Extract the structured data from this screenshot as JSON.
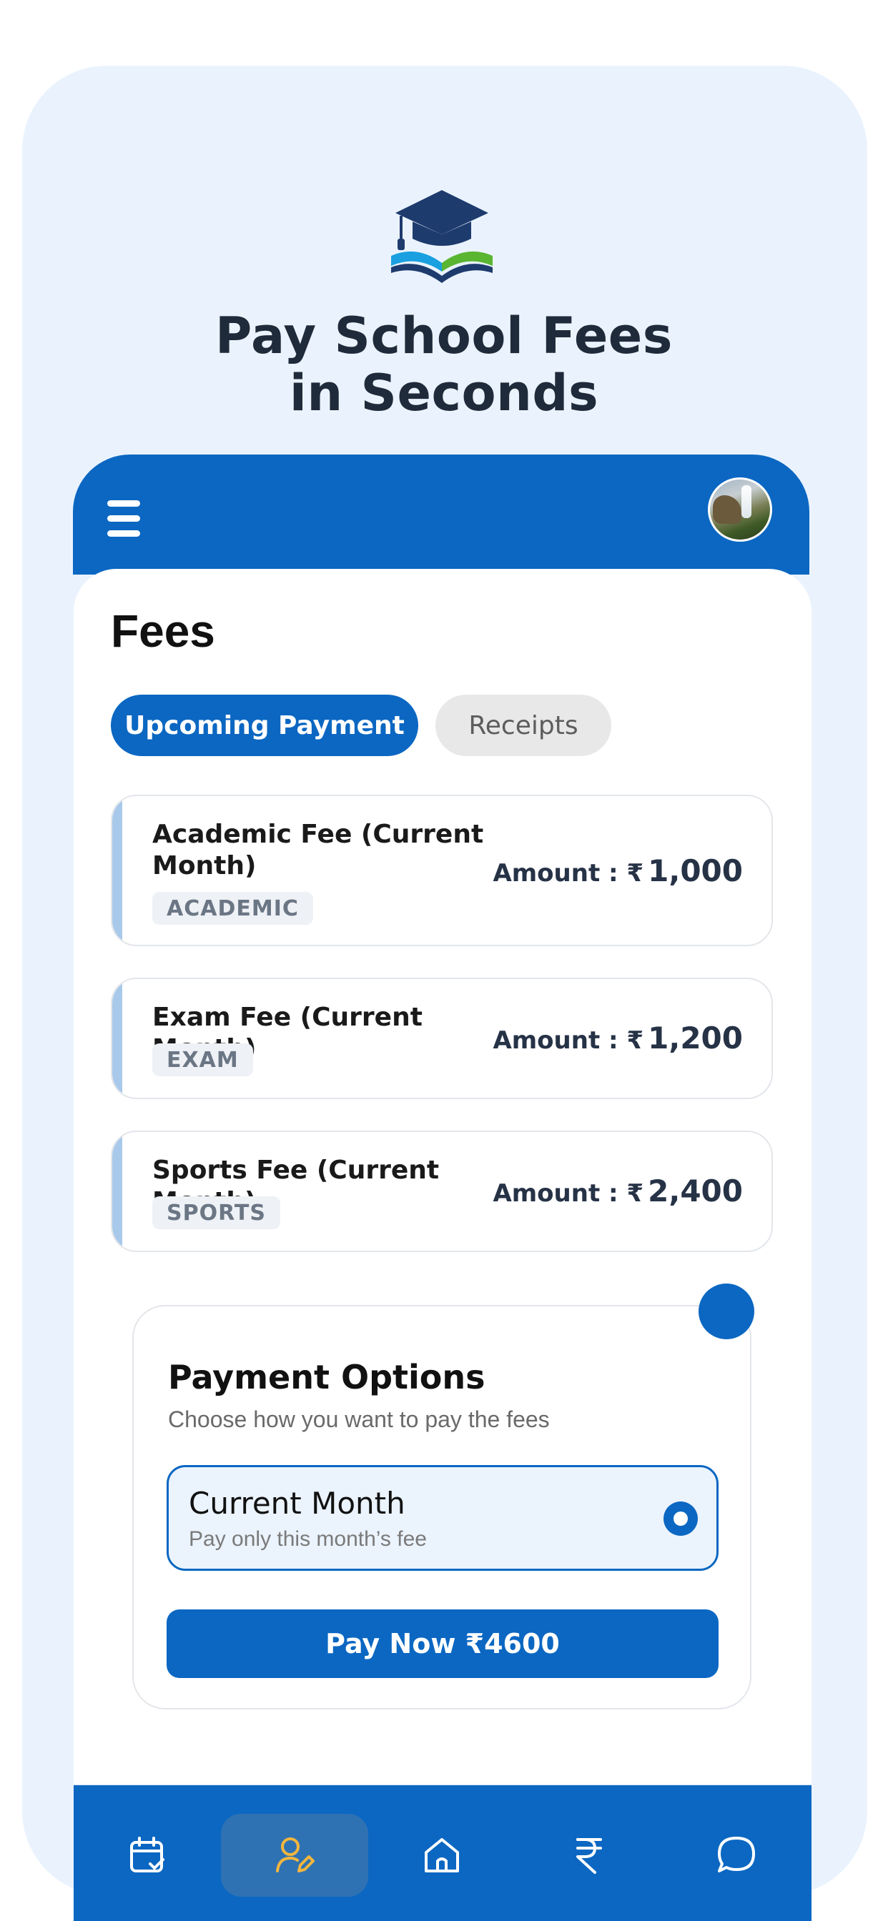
{
  "hero": {
    "title_line1": "Pay School Fees",
    "title_line2": "in Seconds"
  },
  "colors": {
    "primary": "#0b67c2",
    "panel_bg": "#eaf3fd",
    "accent_yellow": "#f3b63d",
    "logo_navy": "#1e3b6e",
    "logo_blue": "#1aa0e0",
    "logo_green": "#5ab531"
  },
  "header": {
    "menu_icon": "hamburger-icon",
    "avatar": "profile-avatar"
  },
  "page": {
    "title": "Fees"
  },
  "tabs": [
    {
      "label": "Upcoming Payment",
      "active": true
    },
    {
      "label": "Receipts",
      "active": false
    }
  ],
  "fees": [
    {
      "name": "Academic Fee (Current Month)",
      "tag": "ACADEMIC",
      "amount_label": "Amount : ₹",
      "amount": "1,000"
    },
    {
      "name": "Exam Fee (Current Month)",
      "tag": "EXAM",
      "amount_label": "Amount : ₹",
      "amount": "1,200"
    },
    {
      "name": "Sports Fee (Current Month)",
      "tag": "SPORTS",
      "amount_label": "Amount : ₹",
      "amount": "2,400"
    }
  ],
  "payment_options": {
    "title": "Payment Options",
    "subtitle": "Choose how you want to pay the fees",
    "option": {
      "title": "Current Month",
      "subtitle": "Pay only this month’s fee",
      "selected": true
    },
    "pay_button": "Pay Now ₹4600"
  },
  "bottom_nav": [
    {
      "icon": "calendar-check-icon",
      "active": false
    },
    {
      "icon": "user-edit-icon",
      "active": true
    },
    {
      "icon": "home-icon",
      "active": false
    },
    {
      "icon": "rupee-icon",
      "active": false
    },
    {
      "icon": "chat-bubble-icon",
      "active": false
    }
  ]
}
